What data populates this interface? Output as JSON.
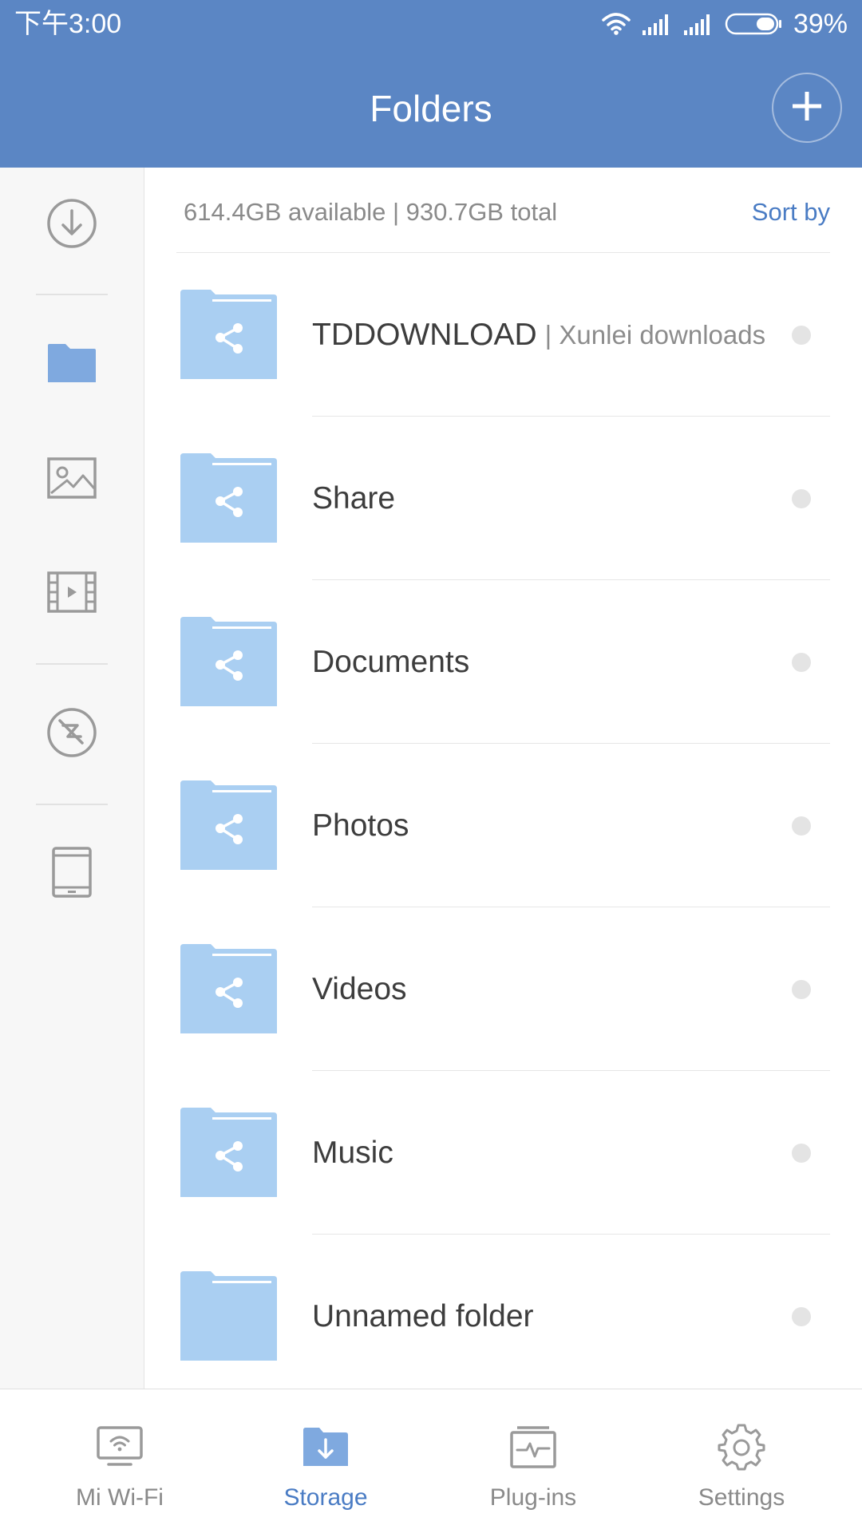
{
  "status_bar": {
    "time": "下午3:00",
    "battery_percent": "39%",
    "battery_level": 0.39,
    "icons": [
      "wifi-icon",
      "signal-icon",
      "signal-icon",
      "battery-icon"
    ]
  },
  "header": {
    "title": "Folders",
    "add_icon": "plus-icon"
  },
  "sidebar": {
    "items": [
      {
        "name": "downloads",
        "icon": "download-circle-icon",
        "active": false
      },
      {
        "name": "folders",
        "icon": "folder-icon",
        "active": true
      },
      {
        "name": "images",
        "icon": "image-icon",
        "active": false
      },
      {
        "name": "videos",
        "icon": "film-icon",
        "active": false
      },
      {
        "name": "thunder",
        "icon": "lightning-circle-icon",
        "active": false
      },
      {
        "name": "tablet",
        "icon": "tablet-icon",
        "active": false
      }
    ]
  },
  "storage": {
    "info": "614.4GB available | 930.7GB total",
    "sort_label": "Sort by"
  },
  "folders": [
    {
      "name": "TDDOWNLOAD",
      "subtitle": "| Xunlei downloads",
      "shared": true
    },
    {
      "name": "Share",
      "subtitle": "",
      "shared": true
    },
    {
      "name": "Documents",
      "subtitle": "",
      "shared": true
    },
    {
      "name": "Photos",
      "subtitle": "",
      "shared": true
    },
    {
      "name": "Videos",
      "subtitle": "",
      "shared": true
    },
    {
      "name": "Music",
      "subtitle": "",
      "shared": true
    },
    {
      "name": "Unnamed folder",
      "subtitle": "",
      "shared": false
    }
  ],
  "bottom_nav": {
    "items": [
      {
        "label": "Mi Wi-Fi",
        "icon": "router-icon",
        "active": false
      },
      {
        "label": "Storage",
        "icon": "storage-icon",
        "active": true
      },
      {
        "label": "Plug-ins",
        "icon": "plugins-icon",
        "active": false
      },
      {
        "label": "Settings",
        "icon": "gear-icon",
        "active": false
      }
    ]
  },
  "colors": {
    "header_bg": "#5b86c4",
    "accent": "#4a7cc4",
    "folder": "#aacff2",
    "sidebar_active": "#7fa9df",
    "icon_gray": "#9a9a9a"
  }
}
